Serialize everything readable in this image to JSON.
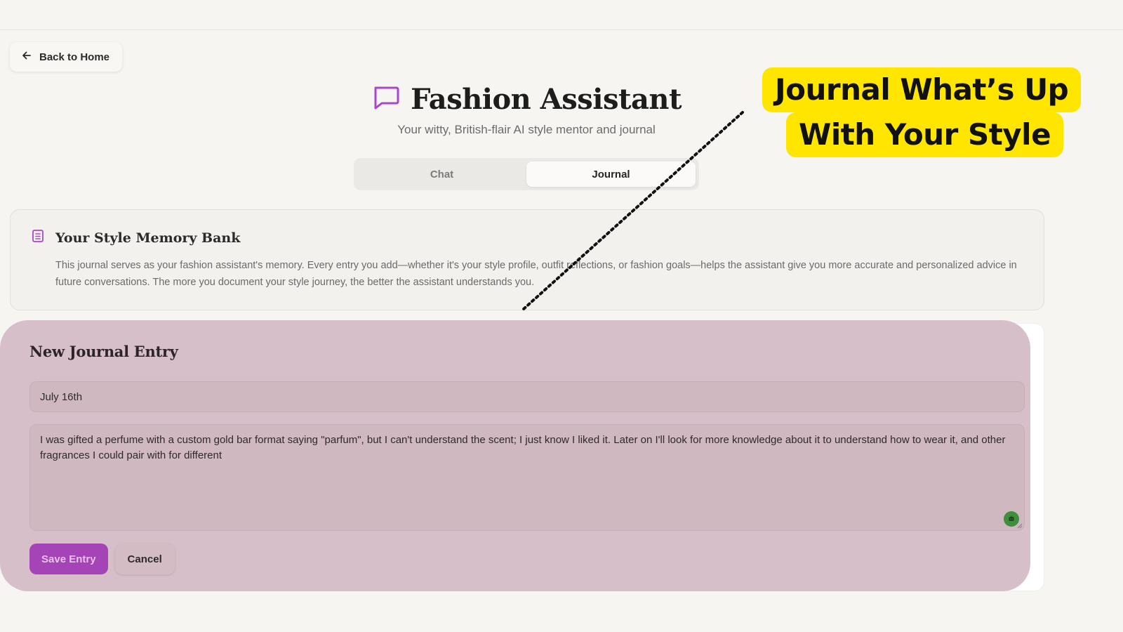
{
  "nav": {
    "back_label": "Back to Home"
  },
  "header": {
    "title": "Fashion Assistant",
    "subtitle": "Your witty, British-flair AI style mentor and journal"
  },
  "tabs": [
    {
      "label": "Chat",
      "active": false
    },
    {
      "label": "Journal",
      "active": true
    }
  ],
  "memory_bank": {
    "title": "Your Style Memory Bank",
    "description": "This journal serves as your fashion assistant's memory. Every entry you add—whether it's your style profile, outfit reflections, or fashion goals—helps the assistant give you more accurate and personalized advice in future conversations. The more you document your style journey, the better the assistant understands you."
  },
  "new_entry": {
    "title": "New Journal Entry",
    "date_value": "July 16th",
    "body_value": "I was gifted a perfume with a custom gold bar format saying \"parfum\", but I can't understand the scent; I just know I liked it. Later on I'll look for more knowledge about it to understand how to wear it, and other fragrances I could pair with for different",
    "save_label": "Save Entry",
    "cancel_label": "Cancel"
  },
  "callout": {
    "line1": "Journal What’s Up",
    "line2": "With Your Style"
  },
  "colors": {
    "accent": "#a544b6",
    "highlight": "#ffe600",
    "entry_overlay": "#d6bfc8"
  },
  "icons": [
    "arrow-left-icon",
    "chat-bubble-icon",
    "notebook-icon",
    "grammar-check-icon"
  ]
}
